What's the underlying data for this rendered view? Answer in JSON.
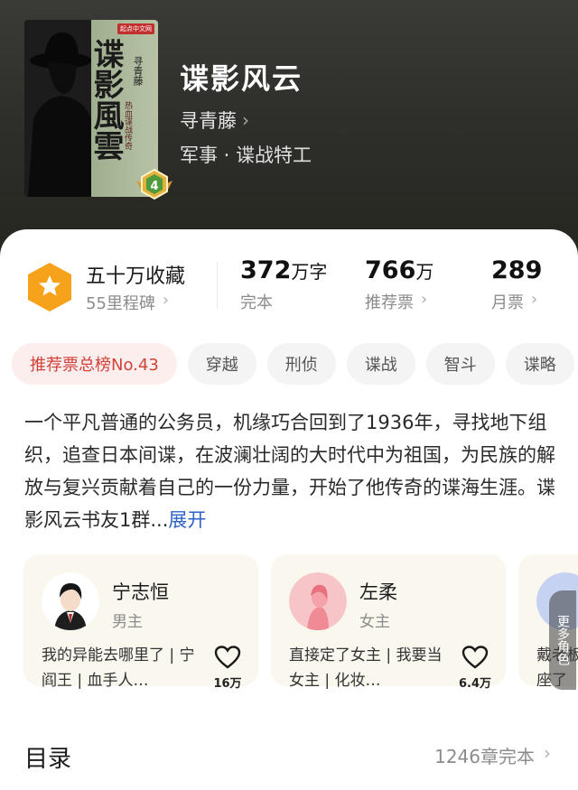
{
  "book": {
    "title": "谍影风云",
    "author": "寻青藤",
    "genre": "军事 · 谍战特工",
    "cover": {
      "title": "谍影風雲",
      "author": "寻青藤",
      "publisher_tag": "起点中文网",
      "subtitle": "热血谍战传奇",
      "level": "4"
    }
  },
  "stats": {
    "milestone": {
      "title": "五十万收藏",
      "sub": "55里程碑"
    },
    "words": {
      "num": "372",
      "unit": "万字",
      "label": "完本"
    },
    "recommend": {
      "num": "766",
      "unit": "万",
      "label": "推荐票"
    },
    "monthly": {
      "num": "289",
      "label": "月票"
    }
  },
  "tags": [
    "推荐票总榜No.43",
    "穿越",
    "刑侦",
    "谍战",
    "智斗",
    "谍略"
  ],
  "synopsis": {
    "text": "一个平凡普通的公务员，机缘巧合回到了1936年，寻找地下组织，追查日本间谍，在波澜壮阔的大时代中为祖国，为民族的解放与复兴贡献着自己的一份力量，开始了他传奇的谍海生涯。谍影风云书友1群...",
    "expand": "展开"
  },
  "characters": [
    {
      "name": "宁志恒",
      "role": "男主",
      "desc": "我的异能去哪里了 | 宁阎王 | 血手人…",
      "likes": "16万"
    },
    {
      "name": "左柔",
      "role": "女主",
      "desc": "直接定了女主 | 我要当女主 | 化妆…",
      "likes": "6.4万"
    },
    {
      "name": "",
      "role": "",
      "desc": "戴老板 座了",
      "likes": ""
    }
  ],
  "more_characters": "更多角色",
  "toc": {
    "title": "目录",
    "meta": "1246章完本"
  },
  "colors": {
    "accent": "#2f62c7",
    "rank_tag": "#d2423a",
    "milestone": "#f7a21b"
  }
}
